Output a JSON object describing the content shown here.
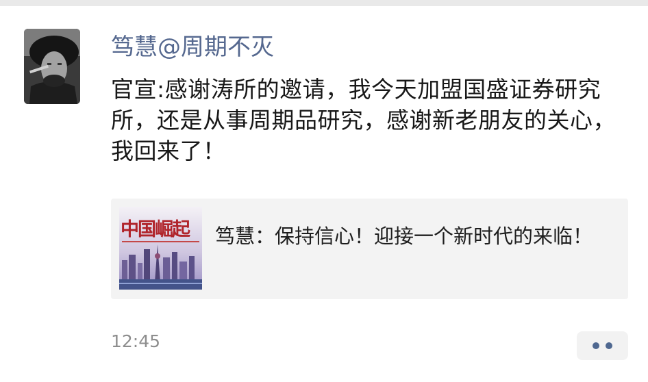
{
  "post": {
    "author": "笃慧@周期不灭",
    "text": "官宣:感谢涛所的邀请，我今天加盟国盛证券研究所，还是从事周期品研究，感谢新老朋友的关心，我回来了！",
    "shared_link": {
      "thumbnail_text": "中国崛起",
      "text": "笃慧：保持信心！迎接一个新时代的来临！"
    },
    "time": "12:45"
  },
  "icons": {
    "avatar": "avatar-photo",
    "more": "more-dots-icon"
  },
  "colors": {
    "name": "#55688f",
    "text": "#181818",
    "card_background": "#f3f3f3",
    "time": "#8d8d8d",
    "dots": "#4f6890"
  }
}
